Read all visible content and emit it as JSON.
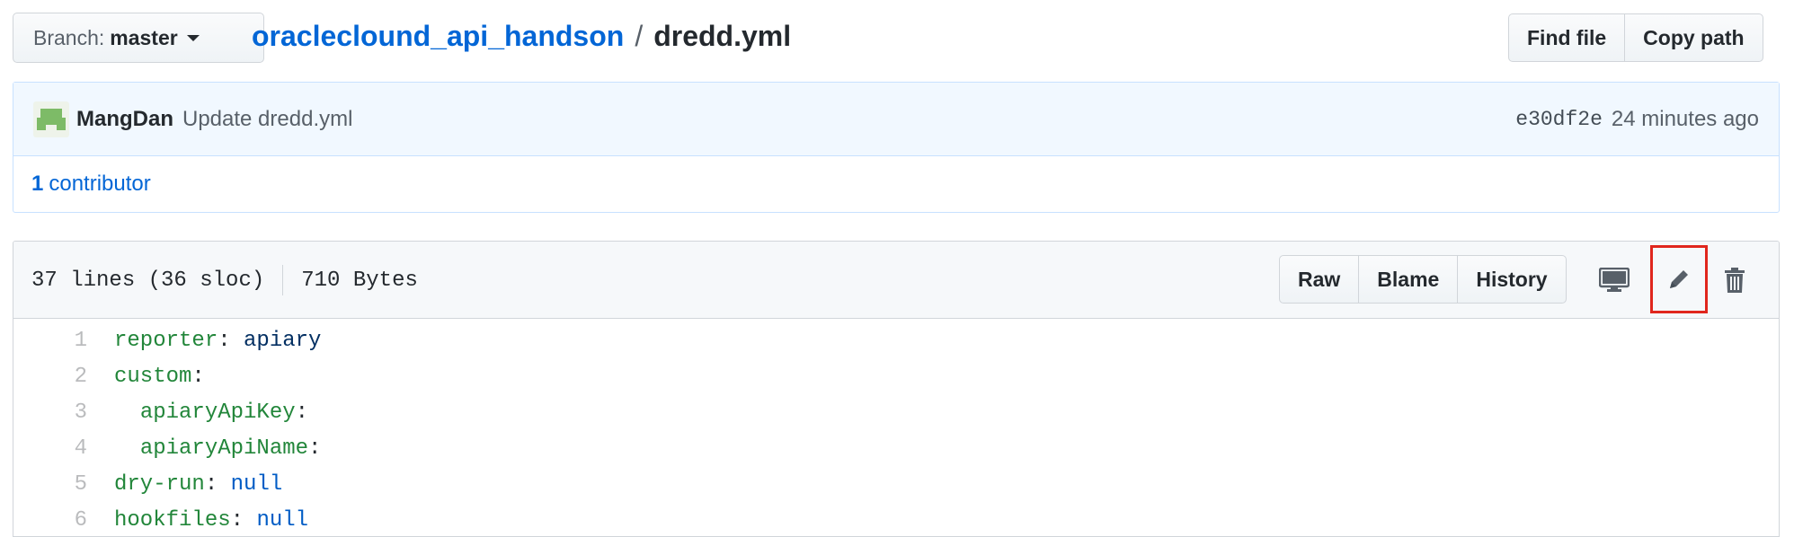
{
  "branch": {
    "label": "Branch:",
    "value": "master"
  },
  "breadcrumb": {
    "repo": "oracleclound_api_handson",
    "separator": "/",
    "file": "dredd.yml"
  },
  "top_actions": {
    "find_file": "Find file",
    "copy_path": "Copy path"
  },
  "commit": {
    "author": "MangDan",
    "message": "Update dredd.yml",
    "sha": "e30df2e",
    "time": "24 minutes ago"
  },
  "contributors": {
    "count": "1",
    "label": "contributor"
  },
  "file": {
    "lines_info": "37 lines (36 sloc)",
    "size": "710 Bytes",
    "actions": {
      "raw": "Raw",
      "blame": "Blame",
      "history": "History"
    },
    "icons": [
      "desktop-icon",
      "pencil-icon",
      "trash-icon"
    ]
  },
  "code_lines": [
    {
      "n": "1",
      "key": "reporter",
      "indent": "",
      "sep": ": ",
      "val": "apiary",
      "val_type": "s"
    },
    {
      "n": "2",
      "key": "custom",
      "indent": "",
      "sep": ":",
      "val": "",
      "val_type": "s"
    },
    {
      "n": "3",
      "key": "apiaryApiKey",
      "indent": "  ",
      "sep": ":",
      "val": "",
      "val_type": "s"
    },
    {
      "n": "4",
      "key": "apiaryApiName",
      "indent": "  ",
      "sep": ":",
      "val": "",
      "val_type": "s"
    },
    {
      "n": "5",
      "key": "dry-run",
      "indent": "",
      "sep": ": ",
      "val": "null",
      "val_type": "c"
    },
    {
      "n": "6",
      "key": "hookfiles",
      "indent": "",
      "sep": ": ",
      "val": "null",
      "val_type": "c"
    }
  ],
  "colors": {
    "link": "#0366d6",
    "highlight_box": "#e0261d",
    "key": "#22863a",
    "constant": "#005cc5"
  }
}
